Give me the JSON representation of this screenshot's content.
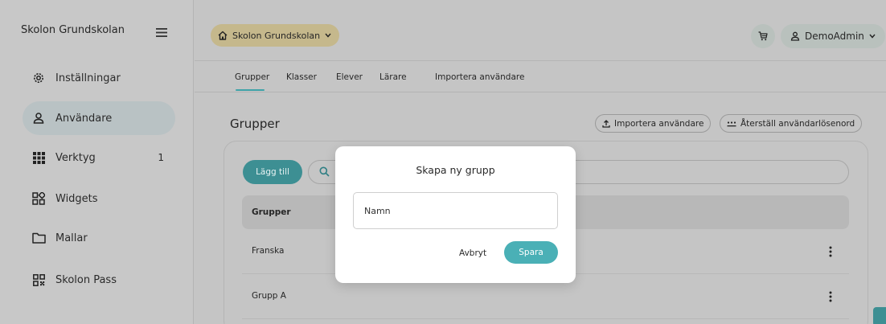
{
  "sidebar": {
    "brand": "Skolon Grundskolan",
    "items": [
      {
        "label": "Inställningar",
        "icon": "gear-icon"
      },
      {
        "label": "Användare",
        "icon": "user-icon",
        "active": true
      },
      {
        "label": "Verktyg",
        "icon": "grid-icon",
        "badge": "1"
      },
      {
        "label": "Widgets",
        "icon": "widgets-icon"
      },
      {
        "label": "Mallar",
        "icon": "folder-icon"
      },
      {
        "label": "Skolon Pass",
        "icon": "qr-code-icon"
      }
    ]
  },
  "header": {
    "school": "Skolon Grundskolan",
    "user": "DemoAdmin"
  },
  "tabs": [
    {
      "label": "Grupper",
      "active": true
    },
    {
      "label": "Klasser"
    },
    {
      "label": "Elever"
    },
    {
      "label": "Lärare"
    },
    {
      "label": "Importera användare"
    }
  ],
  "main": {
    "title": "Grupper",
    "import_button": "Importera användare",
    "reset_button": "Återställ användarlösenord",
    "add_button": "Lägg till",
    "column_header": "Grupper",
    "rows": [
      "Franska",
      "Grupp A"
    ]
  },
  "modal": {
    "title": "Skapa ny grupp",
    "name_placeholder": "Namn",
    "cancel": "Avbryt",
    "save": "Spara"
  },
  "colors": {
    "accent": "#4ab0b6",
    "school_chip": "#c5b88c"
  }
}
